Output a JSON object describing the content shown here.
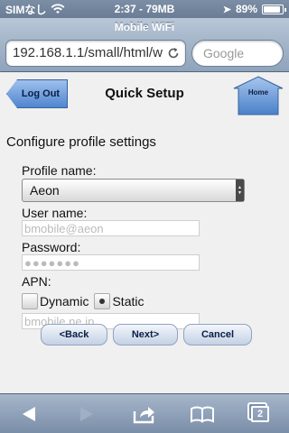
{
  "status_bar": {
    "carrier": "SIMなし",
    "time": "2:37 - 79MB",
    "battery": "89%",
    "battery_level": 0.89
  },
  "browser": {
    "page_title": "Mobile WiFi",
    "url": "192.168.1.1/small/html/w",
    "search_placeholder": "Google"
  },
  "page": {
    "logout_label": "Log Out",
    "title": "Quick Setup",
    "home_label": "Home",
    "section_title": "Configure profile settings",
    "profile_name_label": "Profile name:",
    "profile_name_value": "Aeon",
    "user_name_label": "User name:",
    "user_name_value": "bmobile@aeon",
    "password_label": "Password:",
    "password_value": "●●●●●●●",
    "apn_label": "APN:",
    "apn_options": [
      "Dynamic",
      "Static"
    ],
    "apn_selected": "Static",
    "apn_value": "bmobile.ne.jp",
    "buttons": {
      "back": "<Back",
      "next": "Next>",
      "cancel": "Cancel"
    }
  },
  "toolbar": {
    "icons": [
      "back-icon",
      "forward-icon",
      "share-icon",
      "bookmarks-icon",
      "pages-icon"
    ],
    "pages_count": "2"
  }
}
